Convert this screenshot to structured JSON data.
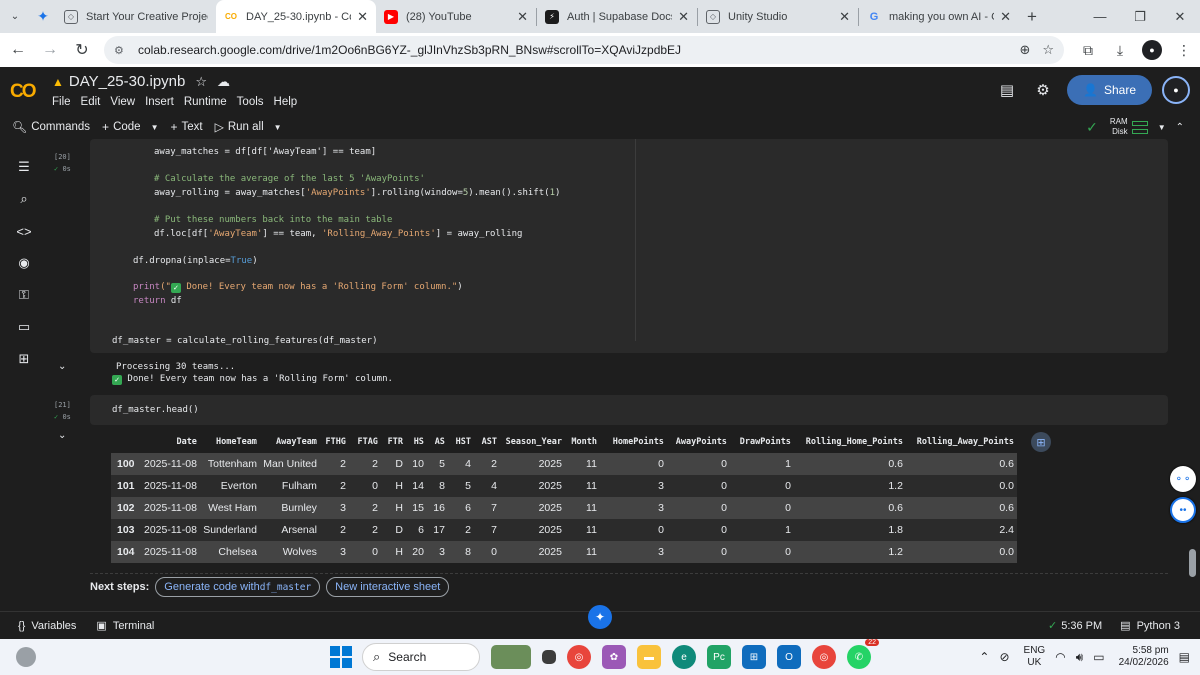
{
  "browser": {
    "tabs": [
      {
        "title": "Start Your Creative Projec",
        "favicon": "unity-icon",
        "active": false
      },
      {
        "title": "DAY_25-30.ipynb - Colab",
        "favicon": "colab-icon",
        "active": true
      },
      {
        "title": "(28) YouTube",
        "favicon": "youtube-icon",
        "active": false
      },
      {
        "title": "Auth | Supabase Docs",
        "favicon": "supabase-icon",
        "active": false
      },
      {
        "title": "Unity Studio",
        "favicon": "unity-icon",
        "active": false
      },
      {
        "title": "making you own AI - Goo",
        "favicon": "google-icon",
        "active": false
      }
    ],
    "url": "colab.research.google.com/drive/1m2Oo6nBG6YZ-_glJInVhzSb3pRN_BNsw#scrollTo=XQAviJzpdbEJ"
  },
  "colab": {
    "notebook_title": "DAY_25-30.ipynb",
    "menu": [
      "File",
      "Edit",
      "View",
      "Insert",
      "Runtime",
      "Tools",
      "Help"
    ],
    "share_label": "Share",
    "toolbar": {
      "commands": "Commands",
      "code": "Code",
      "text": "Text",
      "run_all": "Run all",
      "ram": "RAM",
      "disk": "Disk"
    }
  },
  "cells": {
    "cell20": {
      "exec_count": "[20]",
      "status": "0s",
      "code": {
        "l1": "away_matches = df[df['AwayTeam'] == team]",
        "l2": "# Calculate the average of the last 5 'AwayPoints'",
        "l3a": "away_rolling = away_matches[",
        "l3b": "'AwayPoints'",
        "l3c": "].rolling(window=",
        "l3d": "5",
        "l3e": ").mean().shift(",
        "l3f": "1",
        "l3g": ")",
        "l4": "# Put these numbers back into the main table",
        "l5a": "df.loc[df[",
        "l5b": "'AwayTeam'",
        "l5c": "] == team, ",
        "l5d": "'Rolling_Away_Points'",
        "l5e": "] = away_rolling",
        "l6a": "df.dropna(inplace=",
        "l6b": "True",
        "l6c": ")",
        "l7a": "print(\"",
        "l7b": " Done! Every team now has a 'Rolling Form' column.\"",
        "l7c": ")",
        "l8a": "return",
        "l8b": " df",
        "l9": "df_master = calculate_rolling_features(df_master)"
      },
      "output": {
        "o1": "Processing 30 teams...",
        "o2": " Done! Every team now has a 'Rolling Form' column."
      }
    },
    "cell21": {
      "exec_count": "[21]",
      "status": "0s",
      "code": "df_master.head()"
    }
  },
  "dataframe": {
    "columns": [
      "",
      "Date",
      "HomeTeam",
      "AwayTeam",
      "FTHG",
      "FTAG",
      "FTR",
      "HS",
      "AS",
      "HST",
      "AST",
      "Season_Year",
      "Month",
      "HomePoints",
      "AwayPoints",
      "DrawPoints",
      "Rolling_Home_Points",
      "Rolling_Away_Points"
    ],
    "rows": [
      [
        "100",
        "2025-11-08",
        "Tottenham",
        "Man United",
        "2",
        "2",
        "D",
        "10",
        "5",
        "4",
        "2",
        "2025",
        "11",
        "0",
        "0",
        "1",
        "0.6",
        "0.6"
      ],
      [
        "101",
        "2025-11-08",
        "Everton",
        "Fulham",
        "2",
        "0",
        "H",
        "14",
        "8",
        "5",
        "4",
        "2025",
        "11",
        "3",
        "0",
        "0",
        "1.2",
        "0.0"
      ],
      [
        "102",
        "2025-11-08",
        "West Ham",
        "Burnley",
        "3",
        "2",
        "H",
        "15",
        "16",
        "6",
        "7",
        "2025",
        "11",
        "3",
        "0",
        "0",
        "0.6",
        "0.6"
      ],
      [
        "103",
        "2025-11-08",
        "Sunderland",
        "Arsenal",
        "2",
        "2",
        "D",
        "6",
        "17",
        "2",
        "7",
        "2025",
        "11",
        "0",
        "0",
        "1",
        "1.8",
        "2.4"
      ],
      [
        "104",
        "2025-11-08",
        "Chelsea",
        "Wolves",
        "3",
        "0",
        "H",
        "20",
        "3",
        "8",
        "0",
        "2025",
        "11",
        "3",
        "0",
        "0",
        "1.2",
        "0.0"
      ]
    ]
  },
  "next_steps": {
    "label": "Next steps:",
    "generate_prefix": "Generate code with ",
    "generate_var": "df_master",
    "new_sheet": "New interactive sheet"
  },
  "statusbar": {
    "variables": "Variables",
    "terminal": "Terminal",
    "time": "5:36 PM",
    "runtime": "Python 3"
  },
  "taskbar": {
    "search": "Search",
    "badge_count": "22",
    "lang_1": "ENG",
    "lang_2": "UK",
    "time": "5:58 pm",
    "date": "24/02/2026"
  }
}
